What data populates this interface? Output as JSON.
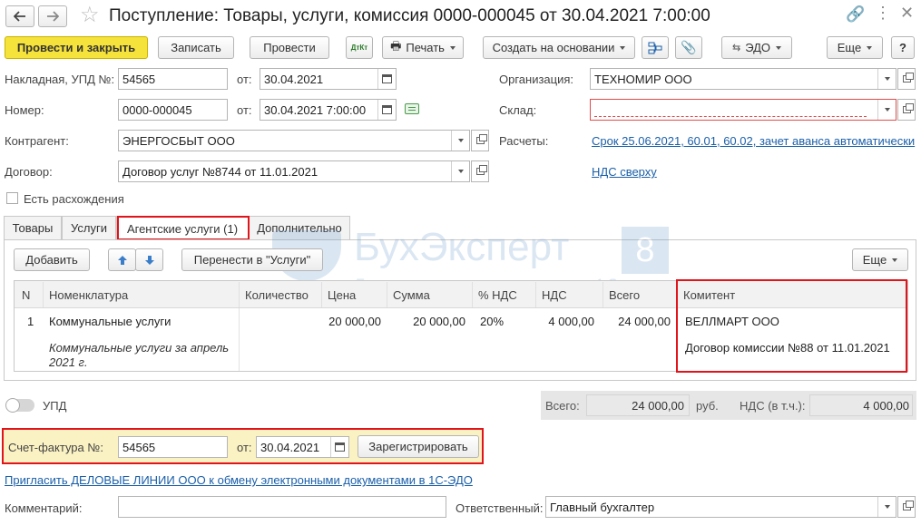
{
  "window": {
    "title": "Поступление: Товары, услуги, комиссия 0000-000045 от  30.04.2021 7:00:00"
  },
  "toolbar": {
    "post_close": "Провести и закрыть",
    "save": "Записать",
    "post": "Провести",
    "dt_kt": "ДтКт",
    "print": "Печать",
    "create_based": "Создать на основании",
    "edo": "ЭДО",
    "more": "Еще",
    "help": "?"
  },
  "fields": {
    "invoice_label": "Накладная, УПД №:",
    "invoice_number": "54565",
    "from_label": "от:",
    "invoice_date": "30.04.2021",
    "number_label": "Номер:",
    "number": "0000-000045",
    "number_date": "30.04.2021  7:00:00",
    "org_label": "Организация:",
    "org": "ТЕХНОМИР ООО",
    "warehouse_label": "Склад:",
    "warehouse": "",
    "counterparty_label": "Контрагент:",
    "counterparty": "ЭНЕРГОСБЫТ ООО",
    "settlements_label": "Расчеты:",
    "settlements_link": "Срок 25.06.2021, 60.01, 60.02, зачет аванса автоматически",
    "contract_label": "Договор:",
    "contract": "Договор услуг №8744 от 11.01.2021",
    "vat_link": "НДС сверху",
    "discrepancy_label": "Есть расхождения"
  },
  "tabs": [
    {
      "label": "Товары"
    },
    {
      "label": "Услуги"
    },
    {
      "label": "Агентские услуги (1)"
    },
    {
      "label": "Дополнительно"
    }
  ],
  "table_toolbar": {
    "add": "Добавить",
    "move_to_services": "Перенести в \"Услуги\"",
    "more": "Еще"
  },
  "watermark": {
    "brand": "БухЭксперт",
    "digit": "8",
    "tagline": "База ответов по учету в 1С"
  },
  "table": {
    "headers": [
      "N",
      "Номенклатура",
      "Количество",
      "Цена",
      "Сумма",
      "% НДС",
      "НДС",
      "Всего",
      "Комитент"
    ],
    "rows": [
      {
        "n": "1",
        "item": "Коммунальные услуги",
        "item_note": "Коммунальные услуги за апрель 2021 г.",
        "qty": "",
        "price": "20 000,00",
        "sum": "20 000,00",
        "vat_rate": "20%",
        "vat": "4 000,00",
        "total": "24 000,00",
        "principal": "ВЕЛЛМАРТ ООО",
        "principal_contract": "Договор комиссии №88 от 11.01.2021"
      }
    ]
  },
  "upd_label": "УПД",
  "totals": {
    "total_label": "Всего:",
    "total_value": "24 000,00",
    "currency": "руб.",
    "vat_label": "НДС (в т.ч.):",
    "vat_value": "4 000,00"
  },
  "invoice": {
    "label": "Счет-фактура №:",
    "number": "54565",
    "from_label": "от:",
    "date": "30.04.2021",
    "register": "Зарегистрировать"
  },
  "edo_invite": "Пригласить ДЕЛОВЫЕ ЛИНИИ ООО к обмену электронными документами в 1С-ЭДО",
  "footer": {
    "comment_label": "Комментарий:",
    "comment": "",
    "responsible_label": "Ответственный:",
    "responsible": "Главный бухгалтер"
  },
  "colors": {
    "primary_button": "#f5e23b",
    "highlight_border": "#e0141a",
    "link": "#1a5fa9",
    "invoice_bg": "#fbf2c3",
    "totals_bg": "#e6e6e6"
  }
}
